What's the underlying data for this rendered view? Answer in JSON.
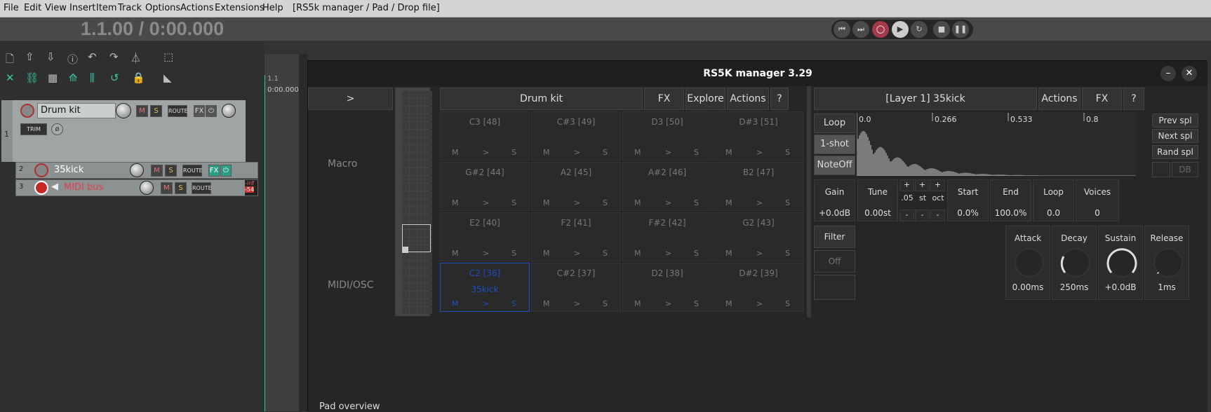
{
  "menubar": {
    "items": [
      "File",
      "Edit",
      "View",
      "Insert",
      "Item",
      "Track",
      "Options",
      "Actions",
      "Extensions",
      "Help"
    ],
    "window_title": "[RS5k manager / Pad / Drop file]"
  },
  "time_display": "1.1.00 / 0:00.000",
  "transport": {
    "buttons": [
      "skip-start",
      "skip-end",
      "record",
      "play",
      "repeat",
      "stop",
      "pause"
    ]
  },
  "ruler": {
    "bar": "1.1",
    "time": "0:00.000"
  },
  "tracks": [
    {
      "num": "1",
      "name": "Drum kit",
      "trim": "TRIM",
      "route": "ROUTE",
      "fx": "FX",
      "m": "M",
      "s": "S"
    },
    {
      "num": "2",
      "name": "35kick",
      "route": "ROUTE",
      "fx": "FX",
      "m": "M",
      "s": "S"
    },
    {
      "num": "3",
      "name": "MIDI bus",
      "route": "ROUTE",
      "m": "M",
      "s": "S",
      "meter": "-inf",
      "meter2": "-54"
    }
  ],
  "rs5k": {
    "title": "RS5K manager 3.29",
    "expand": ">",
    "macro": "Macro",
    "midi_osc": "MIDI/OSC",
    "rack_header": {
      "name": "Drum kit",
      "fx": "FX",
      "explore": "Explore",
      "actions": "Actions",
      "help": "?"
    },
    "pads": [
      {
        "note": "C3 [48]",
        "sample": ""
      },
      {
        "note": "C#3 [49]",
        "sample": ""
      },
      {
        "note": "D3 [50]",
        "sample": ""
      },
      {
        "note": "D#3 [51]",
        "sample": ""
      },
      {
        "note": "G#2 [44]",
        "sample": ""
      },
      {
        "note": "A2 [45]",
        "sample": ""
      },
      {
        "note": "A#2 [46]",
        "sample": ""
      },
      {
        "note": "B2 [47]",
        "sample": ""
      },
      {
        "note": "E2 [40]",
        "sample": ""
      },
      {
        "note": "F2 [41]",
        "sample": ""
      },
      {
        "note": "F#2 [42]",
        "sample": ""
      },
      {
        "note": "G2 [43]",
        "sample": ""
      },
      {
        "note": "C2 [36]",
        "sample": "35kick",
        "selected": true
      },
      {
        "note": "C#2 [37]",
        "sample": ""
      },
      {
        "note": "D2 [38]",
        "sample": ""
      },
      {
        "note": "D#2 [39]",
        "sample": ""
      }
    ],
    "pad_btns": {
      "m": "M",
      "play": ">",
      "s": "S"
    },
    "layer": {
      "title": "[Layer 1] 35kick",
      "actions": "Actions",
      "fx": "FX",
      "help": "?",
      "modes": [
        "Loop",
        "1-shot",
        "NoteOff"
      ],
      "active_mode": "1-shot",
      "wave_ticks": [
        "0.0",
        "0.266",
        "0.533",
        "0.8"
      ],
      "nav": [
        "Prev spl",
        "Next spl",
        "Rand spl"
      ],
      "db": "DB",
      "gain": {
        "label": "Gain",
        "value": "+0.0dB"
      },
      "tune": {
        "label": "Tune",
        "value": "0.00st"
      },
      "steps": {
        "plus": "+",
        "minus": "-",
        "labels": [
          ".05",
          "st",
          "oct"
        ]
      },
      "start": {
        "label": "Start",
        "value": "0.0%"
      },
      "end": {
        "label": "End",
        "value": "100.0%"
      },
      "loop": {
        "label": "Loop",
        "value": "0.0"
      },
      "voices": {
        "label": "Voices",
        "value": "0"
      },
      "filter": {
        "label": "Filter",
        "value": "Off"
      },
      "attack": {
        "label": "Attack",
        "value": "0.00ms"
      },
      "decay": {
        "label": "Decay",
        "value": "250ms"
      },
      "sustain": {
        "label": "Sustain",
        "value": "+0.0dB"
      },
      "release": {
        "label": "Release",
        "value": "1ms"
      }
    },
    "status": "Pad overview"
  }
}
